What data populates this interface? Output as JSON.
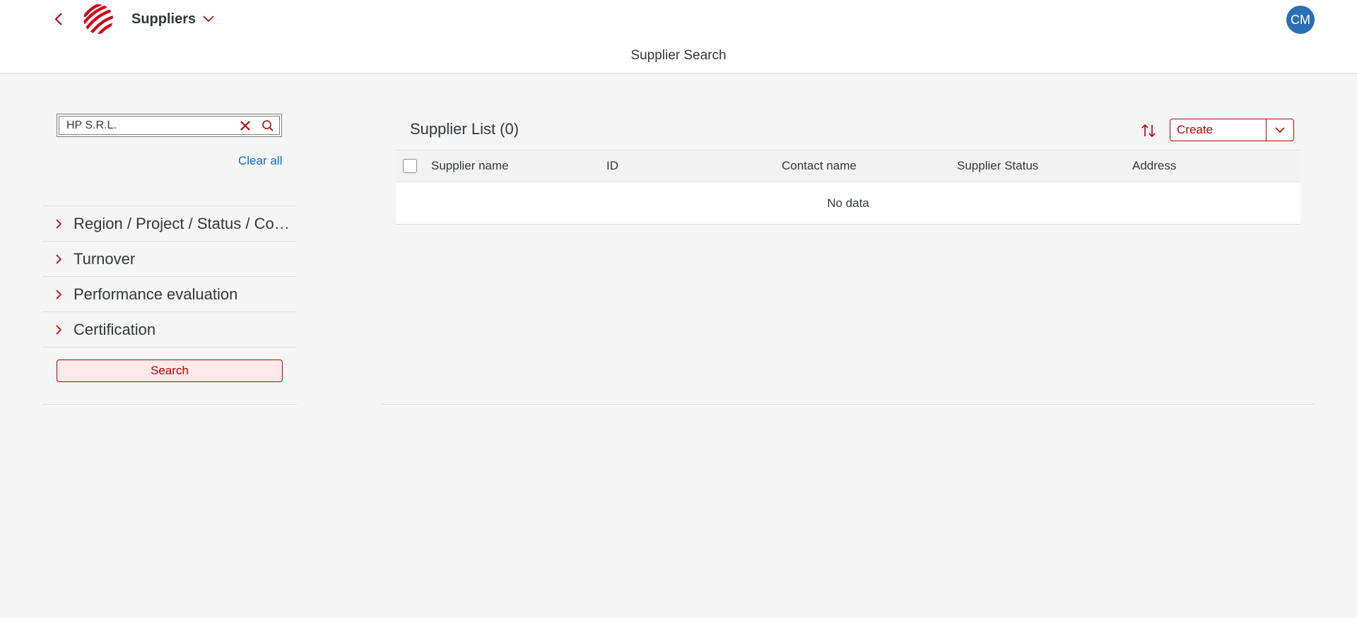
{
  "header": {
    "app_title": "Suppliers",
    "avatar_initials": "CM",
    "page_title": "Supplier Search"
  },
  "filters": {
    "search_value": "HP S.R.L.",
    "clear_all_label": "Clear all",
    "groups": [
      {
        "label": "Region / Project / Status / Company"
      },
      {
        "label": "Turnover"
      },
      {
        "label": "Performance evaluation"
      },
      {
        "label": "Certification"
      }
    ],
    "search_button_label": "Search"
  },
  "supplier_list": {
    "title": "Supplier List (0)",
    "create_label": "Create",
    "columns": [
      "Supplier name",
      "ID",
      "Contact name",
      "Supplier Status",
      "Address"
    ],
    "empty_text": "No data"
  },
  "colors": {
    "accent": "#bb0000",
    "link": "#0a6ed1",
    "avatar": "#2a6fb5"
  }
}
